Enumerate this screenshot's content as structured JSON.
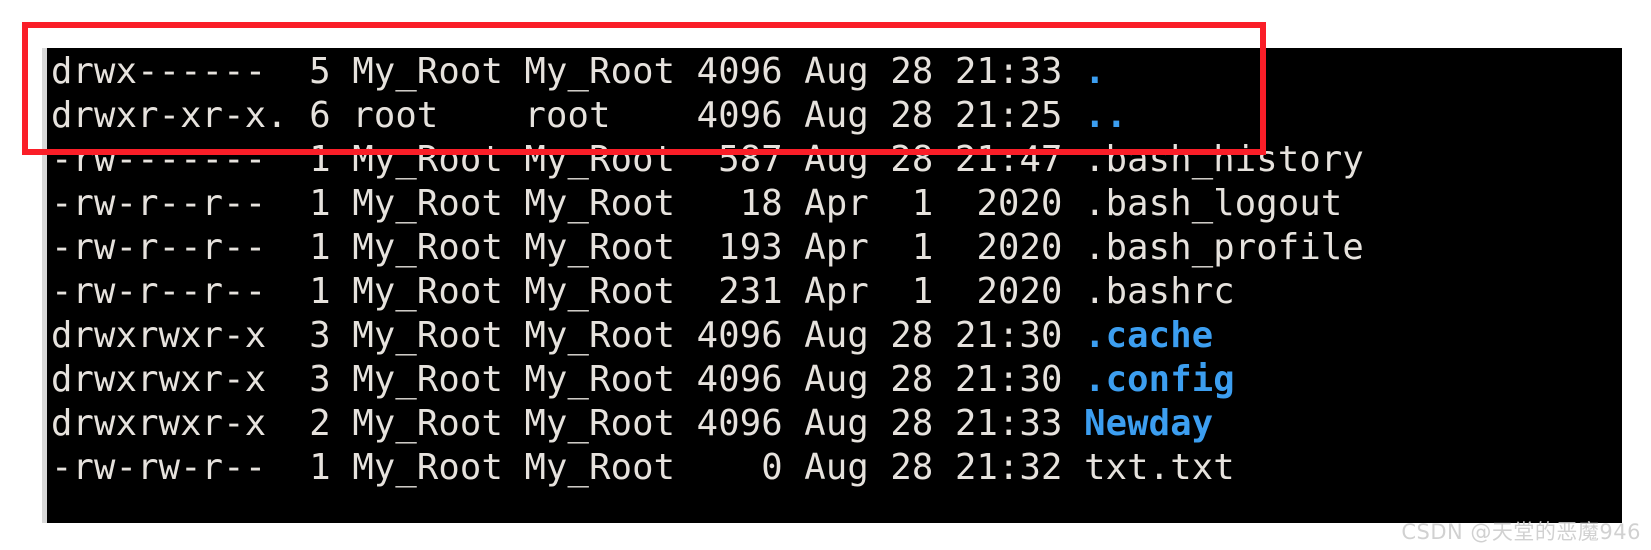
{
  "window": {
    "type": "terminal",
    "background_color": "#000000",
    "foreground_color": "#e6e2dd",
    "directory_color": "#3c9ef0",
    "annotation_color": "#fa1e28"
  },
  "listing": {
    "command_output_type": "ls -la",
    "rows": [
      {
        "permissions": "drwx------",
        "links": "5",
        "owner": "My_Root",
        "group": "My_Root",
        "size": "4096",
        "month": "Aug",
        "day": "28",
        "time": "21:33",
        "name": ".",
        "is_dir": true,
        "highlighted": true
      },
      {
        "permissions": "drwxr-xr-x.",
        "links": "6",
        "owner": "root",
        "group": "root",
        "size": "4096",
        "month": "Aug",
        "day": "28",
        "time": "21:25",
        "name": "..",
        "is_dir": true,
        "highlighted": true
      },
      {
        "permissions": "-rw-------",
        "links": "1",
        "owner": "My_Root",
        "group": "My_Root",
        "size": "587",
        "month": "Aug",
        "day": "28",
        "time": "21:47",
        "name": ".bash_history",
        "is_dir": false,
        "highlighted": false
      },
      {
        "permissions": "-rw-r--r--",
        "links": "1",
        "owner": "My_Root",
        "group": "My_Root",
        "size": "18",
        "month": "Apr",
        "day": "1",
        "time": "2020",
        "name": ".bash_logout",
        "is_dir": false,
        "highlighted": false
      },
      {
        "permissions": "-rw-r--r--",
        "links": "1",
        "owner": "My_Root",
        "group": "My_Root",
        "size": "193",
        "month": "Apr",
        "day": "1",
        "time": "2020",
        "name": ".bash_profile",
        "is_dir": false,
        "highlighted": false
      },
      {
        "permissions": "-rw-r--r--",
        "links": "1",
        "owner": "My_Root",
        "group": "My_Root",
        "size": "231",
        "month": "Apr",
        "day": "1",
        "time": "2020",
        "name": ".bashrc",
        "is_dir": false,
        "highlighted": false
      },
      {
        "permissions": "drwxrwxr-x",
        "links": "3",
        "owner": "My_Root",
        "group": "My_Root",
        "size": "4096",
        "month": "Aug",
        "day": "28",
        "time": "21:30",
        "name": ".cache",
        "is_dir": true,
        "highlighted": false
      },
      {
        "permissions": "drwxrwxr-x",
        "links": "3",
        "owner": "My_Root",
        "group": "My_Root",
        "size": "4096",
        "month": "Aug",
        "day": "28",
        "time": "21:30",
        "name": ".config",
        "is_dir": true,
        "highlighted": false
      },
      {
        "permissions": "drwxrwxr-x",
        "links": "2",
        "owner": "My_Root",
        "group": "My_Root",
        "size": "4096",
        "month": "Aug",
        "day": "28",
        "time": "21:33",
        "name": "Newday",
        "is_dir": true,
        "highlighted": false
      },
      {
        "permissions": "-rw-rw-r--",
        "links": "1",
        "owner": "My_Root",
        "group": "My_Root",
        "size": "0",
        "month": "Aug",
        "day": "28",
        "time": "21:32",
        "name": "txt.txt",
        "is_dir": false,
        "highlighted": false
      }
    ]
  },
  "annotation": {
    "shape": "rectangle",
    "color": "#fa1e28",
    "covers_rows": [
      0,
      1
    ]
  },
  "watermark": {
    "text": "CSDN @天堂的恶魔946"
  }
}
